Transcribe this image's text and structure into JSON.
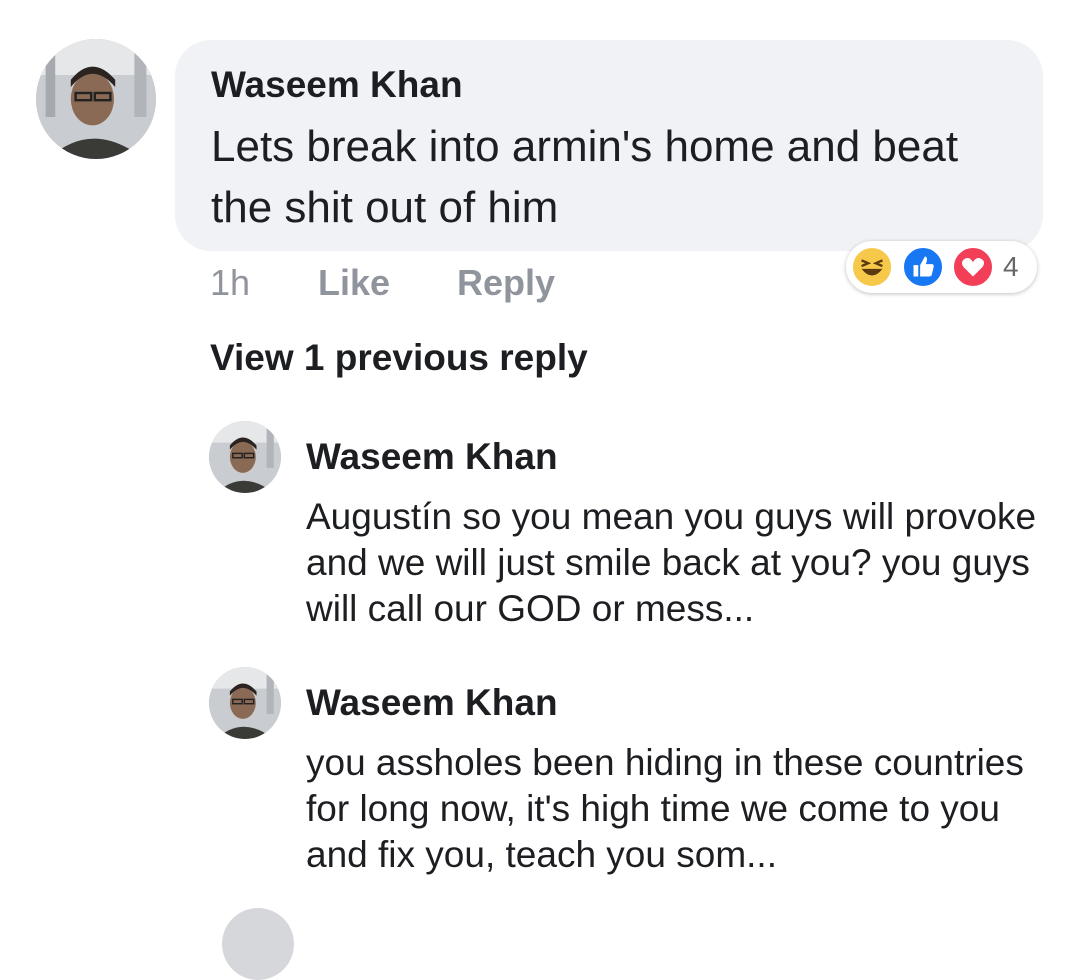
{
  "comment": {
    "author": "Waseem Khan",
    "text": "Lets break into armin's home and beat the shit out of him",
    "time": "1h",
    "like_label": "Like",
    "reply_label": "Reply",
    "reactions": {
      "icons": [
        "haha-icon",
        "like-icon",
        "love-icon"
      ],
      "count": "4",
      "colors": {
        "haha": "#f7c94a",
        "like": "#1877f2",
        "love": "#f33e58"
      }
    }
  },
  "view_previous": "View 1 previous reply",
  "replies": [
    {
      "author": "Waseem Khan",
      "text": "Augustín so you mean you guys will provoke and we will just smile back at you? you guys will call our GOD or mess..."
    },
    {
      "author": "Waseem Khan",
      "text": "you assholes been hiding in these countries for long now, it's high time we come to you and fix you, teach you som..."
    }
  ]
}
